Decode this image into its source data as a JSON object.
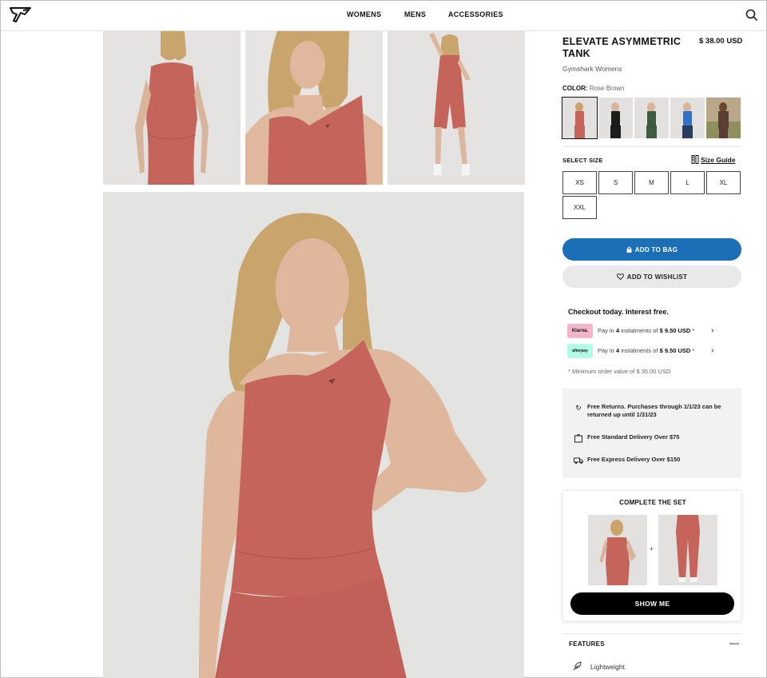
{
  "header": {
    "nav": [
      "WOMENS",
      "MENS",
      "ACCESSORIES"
    ]
  },
  "colors": {
    "accent_blue": "#1a6fb6",
    "product_color": "#c4645a",
    "klarna_pink": "#f5b5c8",
    "afterpay_mint": "#b2fce4"
  },
  "icons": [
    "gymshark-logo-icon",
    "search-icon",
    "ruler-icon",
    "lock-icon",
    "heart-icon",
    "chevron-right-icon",
    "returns-icon",
    "bag-icon",
    "truck-icon",
    "minus-icon",
    "feather-icon"
  ],
  "product": {
    "title": "ELEVATE ASYMMETRIC TANK",
    "price": "$ 38.00 USD",
    "brand": "Gymshark Womens",
    "color_label": "COLOR:",
    "color_value": "Rose Brown",
    "swatches": [
      "Rose Brown",
      "Black",
      "Green",
      "Blue",
      "Brown"
    ],
    "selected_swatch": 0
  },
  "size": {
    "label": "SELECT SIZE",
    "guide": "Size Guide",
    "options": [
      "XS",
      "S",
      "M",
      "L",
      "XL",
      "XXL"
    ]
  },
  "actions": {
    "add_to_bag": "ADD TO BAG",
    "add_to_wishlist": "ADD TO WISHLIST"
  },
  "checkout": {
    "title": "Checkout today. Interest free.",
    "klarna_logo": "Klarna.",
    "afterpay_logo": "afterpay",
    "pay_prefix": "Pay in ",
    "pay_count": "4",
    "pay_middle": " instalments of ",
    "pay_amount": "$ 9.50 USD",
    "pay_suffix": " *",
    "min_order": "* Minimum order value of $ 35.00 USD"
  },
  "perks": [
    "Free Returns. Purchases through 1/1/23 can be returned up until 1/31/23",
    "Free Standard Delivery Over $75",
    "Free Express Delivery Over $150"
  ],
  "complete_set": {
    "title": "COMPLETE THE SET",
    "plus": "+",
    "button": "SHOW ME"
  },
  "features": {
    "title": "FEATURES",
    "toggle": "—",
    "items": [
      "Lightweight"
    ]
  }
}
